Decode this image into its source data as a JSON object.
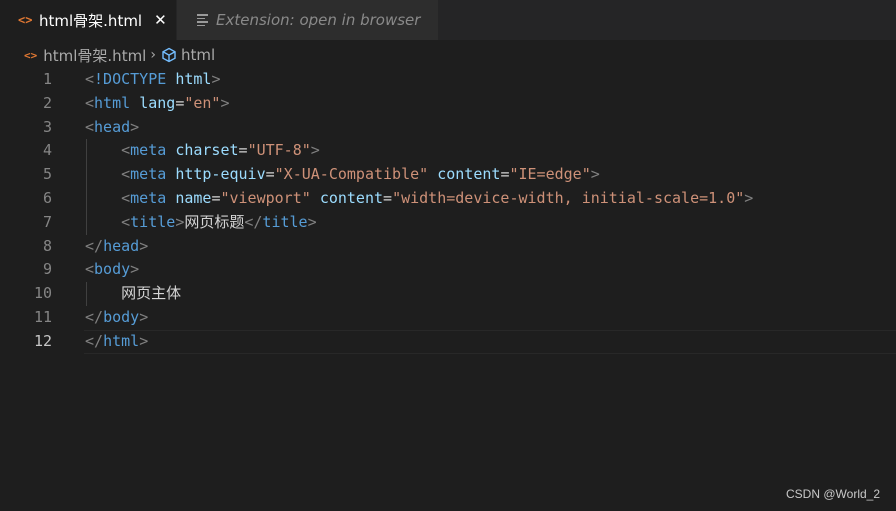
{
  "tabs": [
    {
      "label": "html骨架.html",
      "close": "✕",
      "icon": "html-file-icon"
    },
    {
      "label": "Extension: open in browser",
      "icon": "preview-icon"
    }
  ],
  "breadcrumb": {
    "file": "html骨架.html",
    "symbol": "html"
  },
  "editor": {
    "current_line": 12,
    "lines": [
      {
        "num": "1",
        "indent": "",
        "tokens": [
          [
            "t-punct",
            "<"
          ],
          [
            "t-doctype",
            "!DOCTYPE"
          ],
          [
            "t-text",
            " "
          ],
          [
            "t-dockw",
            "html"
          ],
          [
            "t-punct",
            ">"
          ]
        ]
      },
      {
        "num": "2",
        "indent": "",
        "tokens": [
          [
            "t-punct",
            "<"
          ],
          [
            "t-tag",
            "html"
          ],
          [
            "t-text",
            " "
          ],
          [
            "t-attr",
            "lang"
          ],
          [
            "t-text",
            "="
          ],
          [
            "t-str",
            "\"en\""
          ],
          [
            "t-punct",
            ">"
          ]
        ]
      },
      {
        "num": "3",
        "indent": "",
        "tokens": [
          [
            "t-punct",
            "<"
          ],
          [
            "t-tag",
            "head"
          ],
          [
            "t-punct",
            ">"
          ]
        ]
      },
      {
        "num": "4",
        "indent": "    ",
        "tokens": [
          [
            "t-punct",
            "<"
          ],
          [
            "t-tag",
            "meta"
          ],
          [
            "t-text",
            " "
          ],
          [
            "t-attr",
            "charset"
          ],
          [
            "t-text",
            "="
          ],
          [
            "t-str",
            "\"UTF-8\""
          ],
          [
            "t-punct",
            ">"
          ]
        ]
      },
      {
        "num": "5",
        "indent": "    ",
        "tokens": [
          [
            "t-punct",
            "<"
          ],
          [
            "t-tag",
            "meta"
          ],
          [
            "t-text",
            " "
          ],
          [
            "t-attr",
            "http-equiv"
          ],
          [
            "t-text",
            "="
          ],
          [
            "t-str",
            "\"X-UA-Compatible\""
          ],
          [
            "t-text",
            " "
          ],
          [
            "t-attr",
            "content"
          ],
          [
            "t-text",
            "="
          ],
          [
            "t-str",
            "\"IE=edge\""
          ],
          [
            "t-punct",
            ">"
          ]
        ]
      },
      {
        "num": "6",
        "indent": "    ",
        "tokens": [
          [
            "t-punct",
            "<"
          ],
          [
            "t-tag",
            "meta"
          ],
          [
            "t-text",
            " "
          ],
          [
            "t-attr",
            "name"
          ],
          [
            "t-text",
            "="
          ],
          [
            "t-str",
            "\"viewport\""
          ],
          [
            "t-text",
            " "
          ],
          [
            "t-attr",
            "content"
          ],
          [
            "t-text",
            "="
          ],
          [
            "t-str",
            "\"width=device-width, initial-scale=1.0\""
          ],
          [
            "t-punct",
            ">"
          ]
        ]
      },
      {
        "num": "7",
        "indent": "    ",
        "tokens": [
          [
            "t-punct",
            "<"
          ],
          [
            "t-tag",
            "title"
          ],
          [
            "t-punct",
            ">"
          ],
          [
            "t-text cjk",
            "网页标题"
          ],
          [
            "t-punct",
            "</"
          ],
          [
            "t-tag",
            "title"
          ],
          [
            "t-punct",
            ">"
          ]
        ]
      },
      {
        "num": "8",
        "indent": "",
        "tokens": [
          [
            "t-punct",
            "</"
          ],
          [
            "t-tag",
            "head"
          ],
          [
            "t-punct",
            ">"
          ]
        ]
      },
      {
        "num": "9",
        "indent": "",
        "tokens": [
          [
            "t-punct",
            "<"
          ],
          [
            "t-tag",
            "body"
          ],
          [
            "t-punct",
            ">"
          ]
        ]
      },
      {
        "num": "10",
        "indent": "    ",
        "tokens": [
          [
            "t-text cjk",
            "网页主体"
          ]
        ]
      },
      {
        "num": "11",
        "indent": "",
        "tokens": [
          [
            "t-punct",
            "</"
          ],
          [
            "t-tag",
            "body"
          ],
          [
            "t-punct",
            ">"
          ]
        ]
      },
      {
        "num": "12",
        "indent": "",
        "tokens": [
          [
            "t-punct",
            "</"
          ],
          [
            "t-tag",
            "html"
          ],
          [
            "t-punct",
            ">"
          ]
        ]
      }
    ]
  },
  "watermark": "CSDN @World_2",
  "colors": {
    "background": "#1e1e1e",
    "tag": "#569cd6",
    "attribute": "#9cdcfe",
    "string": "#ce9178",
    "punctuation": "#808080",
    "html_icon": "#e37933"
  }
}
